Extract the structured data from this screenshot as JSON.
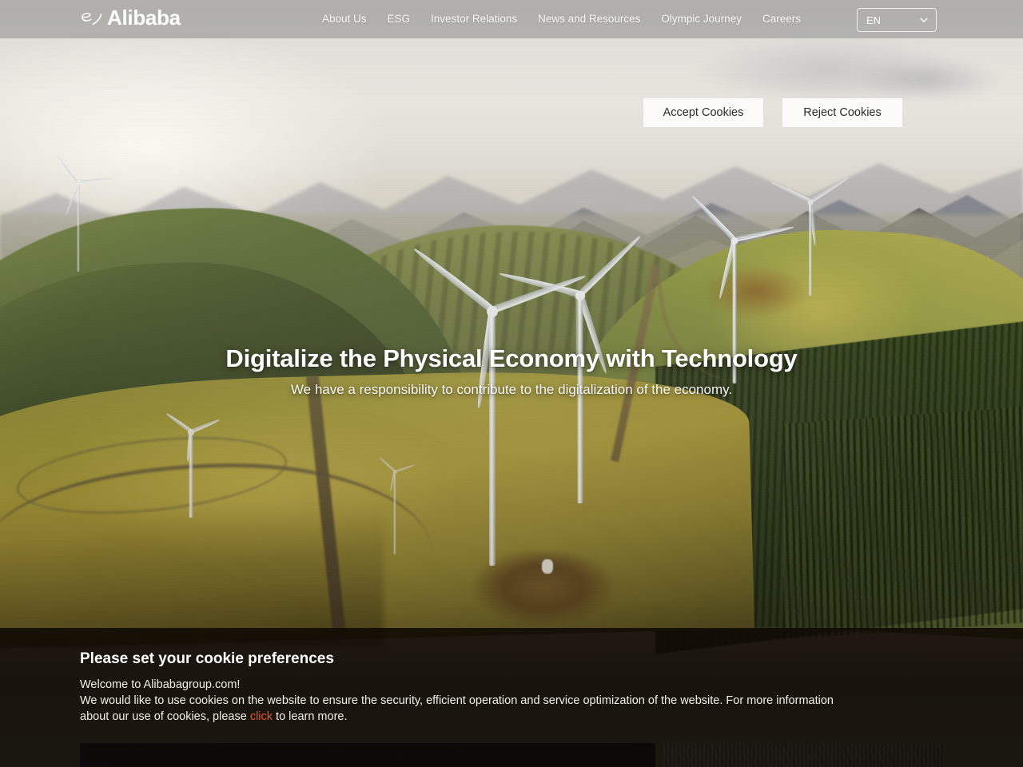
{
  "header": {
    "brand": {
      "name": "Alibaba",
      "mark_icon": "alibaba-logo-icon"
    },
    "nav": [
      {
        "label": "About Us"
      },
      {
        "label": "ESG"
      },
      {
        "label": "Investor Relations"
      },
      {
        "label": "News and Resources"
      },
      {
        "label": "Olympic Journey"
      },
      {
        "label": "Careers"
      }
    ],
    "language": {
      "selected": "EN",
      "chevron_icon": "chevron-down-icon"
    },
    "background_color": "#a0a09c"
  },
  "hero": {
    "title": "Digitalize the Physical Economy with Technology",
    "subtitle": "We have a responsibility to contribute to the digitalization of the economy.",
    "image_description": "aerial-wind-farm-green-hills"
  },
  "cookie_banner": {
    "title": "Please set your cookie preferences",
    "line1": "Welcome to Alibabagroup.com!",
    "line2_before": "We would like to use cookies on the website to ensure the security, efficient operation and service optimization of the website. For more information",
    "line3_before": "about our use of cookies, please ",
    "link_text": "click",
    "line3_after": " to learn more.",
    "accept_label": "Accept Cookies",
    "reject_label": "Reject Cookies",
    "link_color": "#e8552a",
    "button_bg": "#fbfbfa",
    "button_text_color": "#2b2b2b"
  },
  "below_fold": {
    "card_left_color": "#0b1230",
    "card_right_color": "#6d6f73"
  }
}
